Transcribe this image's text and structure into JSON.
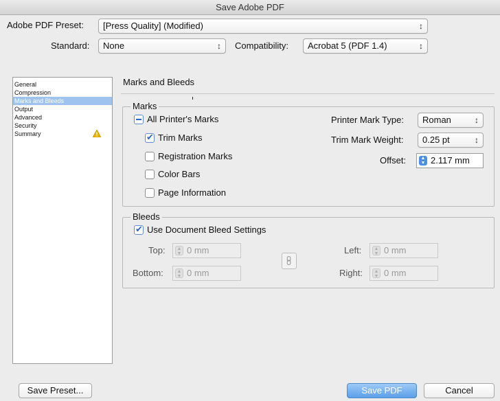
{
  "window": {
    "title": "Save Adobe PDF"
  },
  "header": {
    "preset_label": "Adobe PDF Preset:",
    "preset_value": "[Press Quality] (Modified)",
    "standard_label": "Standard:",
    "standard_value": "None",
    "compat_label": "Compatibility:",
    "compat_value": "Acrobat 5 (PDF 1.4)"
  },
  "sidebar": {
    "items": [
      {
        "label": "General"
      },
      {
        "label": "Compression"
      },
      {
        "label": "Marks and Bleeds"
      },
      {
        "label": "Output"
      },
      {
        "label": "Advanced"
      },
      {
        "label": "Security"
      },
      {
        "label": "Summary"
      }
    ],
    "warning_icon": "warning-triangle-icon",
    "warning_color": "#e8b400"
  },
  "main": {
    "section_title": "Marks and Bleeds",
    "marks": {
      "legend": "Marks",
      "all_printers": "All Printer's Marks",
      "trim": "Trim Marks",
      "registration": "Registration Marks",
      "color_bars": "Color Bars",
      "page_info": "Page Information",
      "type_label": "Printer Mark Type:",
      "type_value": "Roman",
      "weight_label": "Trim Mark Weight:",
      "weight_value": "0.25 pt",
      "offset_label": "Offset:",
      "offset_value": "2.117 mm",
      "checks": {
        "all_printers": "mixed",
        "trim": true,
        "registration": false,
        "color_bars": false,
        "page_info": false
      }
    },
    "bleeds": {
      "legend": "Bleeds",
      "use_doc": "Use Document Bleed Settings",
      "use_doc_checked": true,
      "top_label": "Top:",
      "top_value": "0 mm",
      "bottom_label": "Bottom:",
      "bottom_value": "0 mm",
      "left_label": "Left:",
      "left_value": "0 mm",
      "right_label": "Right:",
      "right_value": "0 mm",
      "link_icon": "chain-link-icon"
    }
  },
  "footer": {
    "save_preset": "Save Preset...",
    "save_pdf": "Save PDF",
    "cancel": "Cancel"
  },
  "colors": {
    "accent": "#5a9fe9",
    "selection": "#9fc3ef"
  }
}
